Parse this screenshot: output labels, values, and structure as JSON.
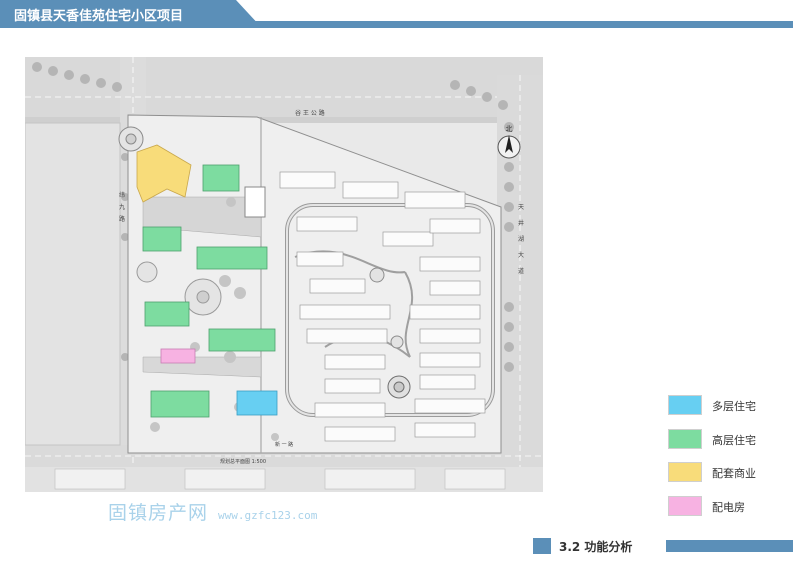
{
  "header": {
    "title": "固镇县天香佳苑住宅小区项目"
  },
  "plan": {
    "north_label": "北",
    "road_top": "谷 王 公 路",
    "road_right": [
      "天",
      "井",
      "湖",
      "大",
      "道"
    ],
    "road_left": [
      "纬",
      "九",
      "路"
    ],
    "road_bottom": "新 一 路",
    "caption": "规划总平面图  1:500"
  },
  "legend": {
    "items": [
      {
        "label": "多层住宅",
        "color": "#67cff2"
      },
      {
        "label": "高层住宅",
        "color": "#7ddca0"
      },
      {
        "label": "配套商业",
        "color": "#f8dc7a"
      },
      {
        "label": "配电房",
        "color": "#f7b2e2"
      }
    ]
  },
  "watermark": {
    "text": "固镇房产网",
    "url": "www.gzfc123.com"
  },
  "footer": {
    "section_title": "3.2  功能分析"
  }
}
